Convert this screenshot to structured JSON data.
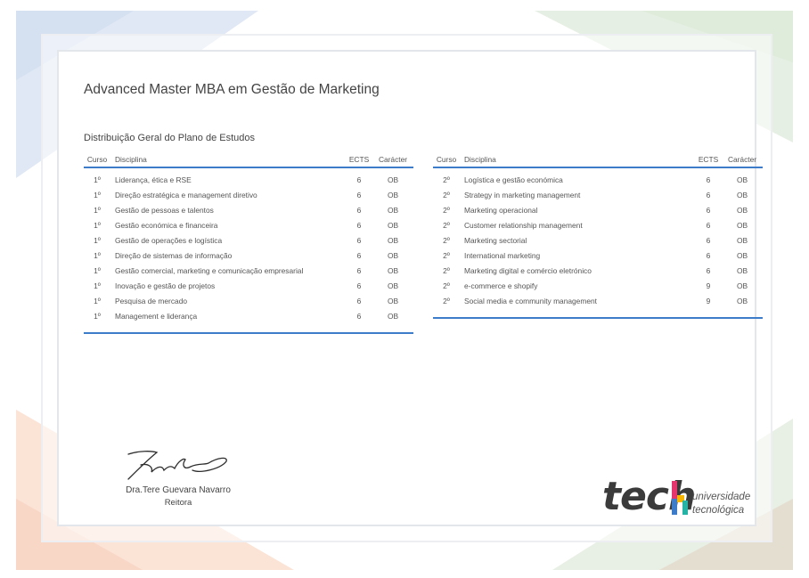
{
  "certificate": {
    "title": "Advanced Master MBA em Gestão de Marketing",
    "subtitle": "Distribuição Geral do Plano de Estudos"
  },
  "table_headers": {
    "curso": "Curso",
    "disciplina": "Disciplina",
    "ects": "ECTS",
    "caracter": "Carácter"
  },
  "left_table": [
    {
      "curso": "1º",
      "disciplina": "Liderança, ética e RSE",
      "ects": "6",
      "caracter": "OB"
    },
    {
      "curso": "1º",
      "disciplina": "Direção estratégica e management diretivo",
      "ects": "6",
      "caracter": "OB"
    },
    {
      "curso": "1º",
      "disciplina": "Gestão de pessoas e talentos",
      "ects": "6",
      "caracter": "OB"
    },
    {
      "curso": "1º",
      "disciplina": "Gestão económica e financeira",
      "ects": "6",
      "caracter": "OB"
    },
    {
      "curso": "1º",
      "disciplina": "Gestão de operações e logística",
      "ects": "6",
      "caracter": "OB"
    },
    {
      "curso": "1º",
      "disciplina": "Direção de sistemas de informação",
      "ects": "6",
      "caracter": "OB"
    },
    {
      "curso": "1º",
      "disciplina": "Gestão comercial, marketing e comunicação empresarial",
      "ects": "6",
      "caracter": "OB"
    },
    {
      "curso": "1º",
      "disciplina": "Inovação e gestão de projetos",
      "ects": "6",
      "caracter": "OB"
    },
    {
      "curso": "1º",
      "disciplina": "Pesquisa de mercado",
      "ects": "6",
      "caracter": "OB"
    },
    {
      "curso": "1º",
      "disciplina": "Management e liderança",
      "ects": "6",
      "caracter": "OB"
    }
  ],
  "right_table": [
    {
      "curso": "2º",
      "disciplina": "Logística e gestão económica",
      "ects": "6",
      "caracter": "OB"
    },
    {
      "curso": "2º",
      "disciplina": "Strategy in marketing management",
      "ects": "6",
      "caracter": "OB"
    },
    {
      "curso": "2º",
      "disciplina": "Marketing operacional",
      "ects": "6",
      "caracter": "OB"
    },
    {
      "curso": "2º",
      "disciplina": "Customer relationship management",
      "ects": "6",
      "caracter": "OB"
    },
    {
      "curso": "2º",
      "disciplina": "Marketing sectorial",
      "ects": "6",
      "caracter": "OB"
    },
    {
      "curso": "2º",
      "disciplina": "International marketing",
      "ects": "6",
      "caracter": "OB"
    },
    {
      "curso": "2º",
      "disciplina": "Marketing digital e comércio eletrónico",
      "ects": "6",
      "caracter": "OB"
    },
    {
      "curso": "2º",
      "disciplina": "e-commerce e shopify",
      "ects": "9",
      "caracter": "OB"
    },
    {
      "curso": "2º",
      "disciplina": "Social media e community management",
      "ects": "9",
      "caracter": "OB"
    }
  ],
  "signatory": {
    "name": "Dra.Tere Guevara Navarro",
    "role": "Reitora"
  },
  "logo": {
    "wordmark": "tech",
    "line1": "universidade",
    "line2": "tecnológica",
    "accent_colors": [
      "#e5356f",
      "#f7b500",
      "#25b3a5",
      "#3d7cc9"
    ]
  },
  "colors": {
    "rule": "#3d7cc9",
    "corner_blue": "#dde8f5",
    "corner_green": "#e4efe2",
    "corner_peach": "#fbe0d3",
    "corner_tan": "#ece3d6"
  }
}
